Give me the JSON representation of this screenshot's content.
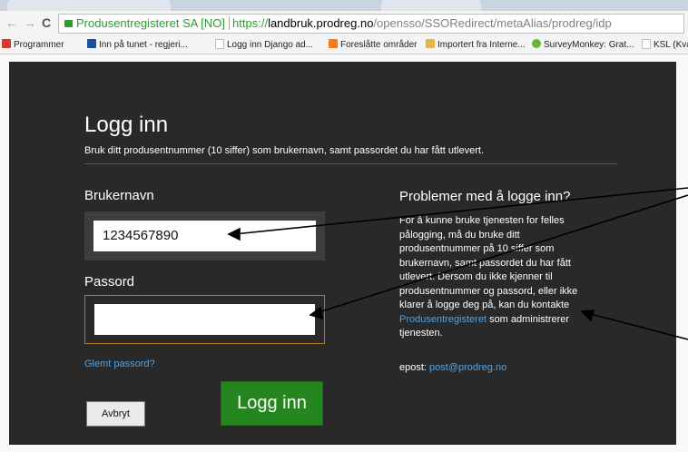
{
  "browser": {
    "site_identity": "Produsentregisteret SA [NO]",
    "url_scheme": "https://",
    "url_host": "landbruk.prodreg.no",
    "url_path": "/opensso/SSORedirect/metaAlias/prodreg/idp",
    "nav_icons": [
      "back-arrow-icon",
      "forward-arrow-icon",
      "reload-icon",
      "lock-icon"
    ],
    "bookmarks": [
      {
        "label": "Programmer",
        "icon": "apps-grid-icon",
        "color": "#d23b2b"
      },
      {
        "label": "Inn på tunet - regjeri...",
        "icon": "govt-crest-icon",
        "color": "#1f4f9c"
      },
      {
        "label": "Logg inn Django ad...",
        "icon": "page-icon",
        "color": "#bdbdbd"
      },
      {
        "label": "Foreslåtte områder",
        "icon": "suggested-icon",
        "color": "#f27a1a"
      },
      {
        "label": "Importert fra Interne...",
        "icon": "folder-icon",
        "color": "#e0b84a"
      },
      {
        "label": "SurveyMonkey: Grat...",
        "icon": "surveymonkey-icon",
        "color": "#6bb23a"
      },
      {
        "label": "KSL (Kvalitet",
        "icon": "page-icon",
        "color": "#bdbdbd"
      }
    ]
  },
  "login": {
    "title": "Logg inn",
    "subtitle": "Bruk ditt produsentnummer (10 siffer) som brukernavn, samt passordet du har fått utlevert.",
    "username_label": "Brukernavn",
    "username_value": "1234567890",
    "password_label": "Passord",
    "password_value": "",
    "forgot_link": "Glemt passord?",
    "cancel_button": "Avbryt",
    "login_button": "Logg inn"
  },
  "help": {
    "title": "Problemer med å logge inn?",
    "text_before_link": "For å kunne bruke tjenesten for felles pålogging, må du bruke ditt produsentnummer på 10 siffer som brukernavn, samt passordet du har fått utlevert. Dersom du ikke kjenner til produsentnummer og passord, eller ikke klarer å logge deg på, kan du kontakte",
    "link_text": "Produsentregisteret",
    "text_after_link": "som administrerer tjenesten.",
    "email_label": "epost:",
    "email": "post@prodreg.no"
  },
  "colors": {
    "panel_bg": "#292929",
    "login_button": "#25861f",
    "link": "#4fa3e6",
    "focus_border": "#b07a18"
  }
}
